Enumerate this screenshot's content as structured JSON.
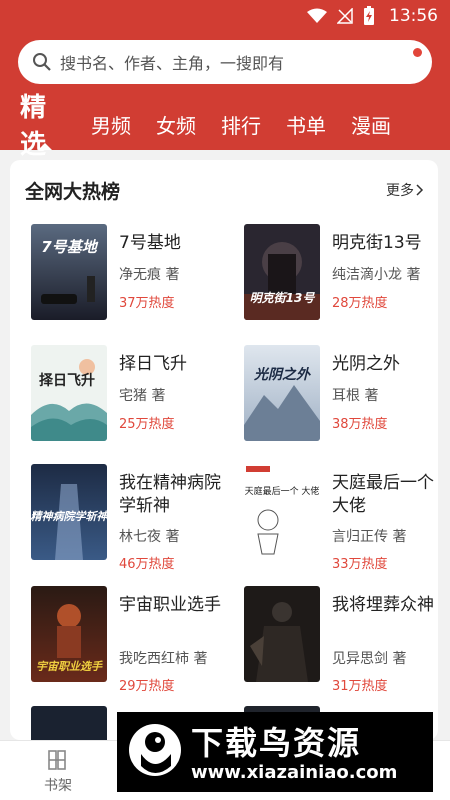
{
  "status": {
    "time": "13:56"
  },
  "search": {
    "placeholder": "搜书名、作者、主角，一搜即有"
  },
  "tabs": [
    "精选",
    "男频",
    "女频",
    "排行",
    "书单",
    "漫画"
  ],
  "section": {
    "title": "全网大热榜",
    "more": "更多"
  },
  "books": [
    {
      "title": "7号基地",
      "author": "净无痕 著",
      "heat": "37万热度"
    },
    {
      "title": "明克街13号",
      "author": "纯洁滴小龙 著",
      "heat": "28万热度"
    },
    {
      "title": "择日飞升",
      "author": "宅猪 著",
      "heat": "25万热度"
    },
    {
      "title": "光阴之外",
      "author": "耳根 著",
      "heat": "38万热度"
    },
    {
      "title": "我在精神病院学斩神",
      "author": "林七夜 著",
      "heat": "46万热度"
    },
    {
      "title": "天庭最后一个大佬",
      "author": "言归正传 著",
      "heat": "33万热度"
    },
    {
      "title": "宇宙职业选手",
      "author": "我吃西红柿 著",
      "heat": "29万热度"
    },
    {
      "title": "我将埋葬众神",
      "author": "见异思剑 著",
      "heat": "31万热度"
    }
  ],
  "covers": [
    {
      "text": "7号基地"
    },
    {
      "text": "明克街13号"
    },
    {
      "text": "择日飞升"
    },
    {
      "text": "光阴之外"
    },
    {
      "text": "精神病院学斩神"
    },
    {
      "text": "天庭最后一个 大佬"
    },
    {
      "text": "宇宙职业选手"
    },
    {
      "text": ""
    }
  ],
  "bottom_nav": {
    "bookshelf": "书架"
  },
  "watermark": {
    "main": "下载鸟资源",
    "url": "www.xiazainiao.com"
  },
  "colors": {
    "brand": "#d13d33",
    "heat": "#e0483c"
  }
}
